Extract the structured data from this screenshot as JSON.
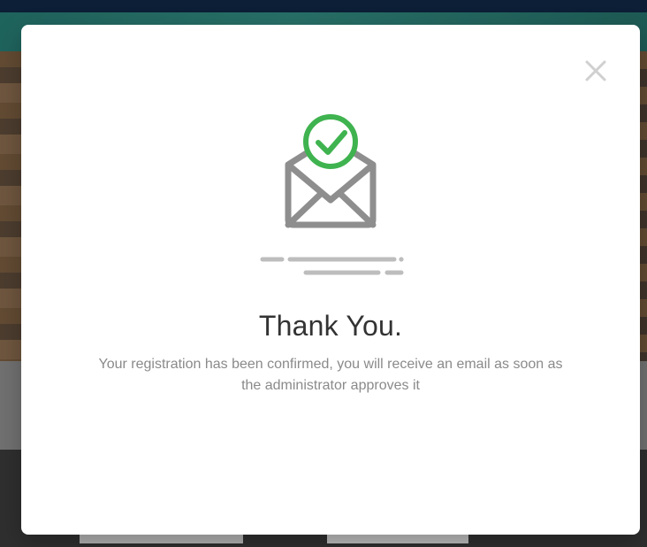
{
  "modal": {
    "title": "Thank You.",
    "message": "Your registration has been confirmed, you will receive an email as soon as the administrator approves it"
  },
  "icons": {
    "close": "close-icon",
    "envelope": "envelope-icon",
    "check": "check-circle-icon"
  },
  "colors": {
    "success": "#3fb34f",
    "icon_gray": "#8e8e8e",
    "line_gray": "#bdbdbd",
    "close_gray": "#d0d0d0"
  }
}
